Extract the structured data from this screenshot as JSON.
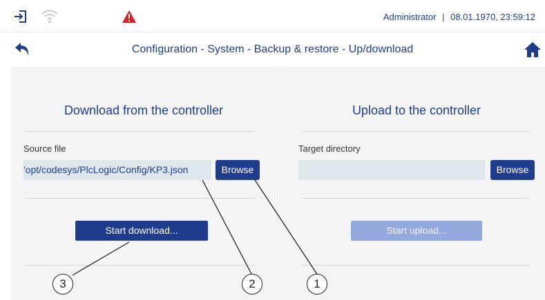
{
  "status": {
    "user": "Administrator",
    "separator": "|",
    "datetime": "08.01.1970, 23:59:12"
  },
  "title": "Configuration - System - Backup & restore - Up/download",
  "download": {
    "heading": "Download from the controller",
    "source_label": "Source file",
    "source_value": "'opt/codesys/PlcLogic/Config/KP3.json",
    "browse_label": "Browse",
    "start_label": "Start download..."
  },
  "upload": {
    "heading": "Upload to the controller",
    "target_label": "Target directory",
    "target_value": "",
    "browse_label": "Browse",
    "start_label": "Start upload..."
  },
  "callouts": [
    "1",
    "2",
    "3"
  ],
  "icons": {
    "login": "login-icon",
    "wifi": "wifi-icon",
    "warning": "warning-icon",
    "back": "back-arrow-icon",
    "home": "home-icon"
  },
  "colors": {
    "accent": "#1f3d8c",
    "warning": "#d62027",
    "disabled_button": "#93a9de",
    "panel_bg": "#f4f4f4",
    "field_bg": "#dde7ec"
  }
}
